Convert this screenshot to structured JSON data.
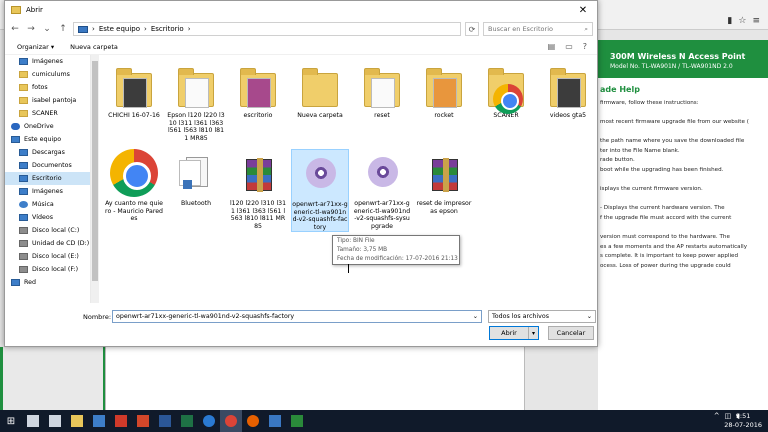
{
  "dialog": {
    "title": "Abrir",
    "close_label": "✕",
    "address": {
      "segments": [
        "Este equipo",
        "Escritorio"
      ]
    },
    "search_placeholder": "Buscar en Escritorio",
    "toolbar": {
      "organize": "Organizar ▾",
      "new_folder": "Nueva carpeta"
    }
  },
  "nav_pane": [
    {
      "label": "Imágenes",
      "icon": "blue",
      "indent": 14
    },
    {
      "label": "cumiculums",
      "icon": "folder",
      "indent": 14
    },
    {
      "label": "fotos",
      "icon": "folder",
      "indent": 14
    },
    {
      "label": "isabel pantoja",
      "icon": "folder",
      "indent": 14
    },
    {
      "label": "SCANER",
      "icon": "folder",
      "indent": 14
    },
    {
      "label": "OneDrive",
      "icon": "cloud",
      "indent": 6
    },
    {
      "label": "Este equipo",
      "icon": "blue",
      "indent": 6
    },
    {
      "label": "Descargas",
      "icon": "blue",
      "indent": 14
    },
    {
      "label": "Documentos",
      "icon": "blue",
      "indent": 14
    },
    {
      "label": "Escritorio",
      "icon": "blue",
      "indent": 14,
      "selected": true
    },
    {
      "label": "Imágenes",
      "icon": "blue",
      "indent": 14
    },
    {
      "label": "Música",
      "icon": "music",
      "indent": 14
    },
    {
      "label": "Vídeos",
      "icon": "blue",
      "indent": 14
    },
    {
      "label": "Disco local (C:)",
      "icon": "drive",
      "indent": 14
    },
    {
      "label": "Unidad de CD (D:)",
      "icon": "drive",
      "indent": 14
    },
    {
      "label": "Disco local (E:)",
      "icon": "drive",
      "indent": 14
    },
    {
      "label": "Disco local (F:)",
      "icon": "drive",
      "indent": 14
    },
    {
      "label": "Red",
      "icon": "blue",
      "indent": 6
    }
  ],
  "files": [
    {
      "label": "CHICHI 16-07-16",
      "type": "folder",
      "paper": "dark"
    },
    {
      "label": "Epson l120 l220 l310 l311 l361 l363 l561 l563 l810 l811 MR85",
      "type": "folder",
      "paper": "light"
    },
    {
      "label": "escritorio",
      "type": "folder",
      "paper": "purple"
    },
    {
      "label": "Nueva carpeta",
      "type": "folder",
      "paper": "none"
    },
    {
      "label": "reset",
      "type": "folder",
      "paper": "light"
    },
    {
      "label": "rocket",
      "type": "folder",
      "paper": "orange"
    },
    {
      "label": "SCANER",
      "type": "folder-chrome",
      "paper": "none"
    },
    {
      "label": "videos gta5",
      "type": "folder",
      "paper": "dark"
    },
    {
      "label": "Ay cuanto me quiero - Mauricio Paredes",
      "type": "chrome"
    },
    {
      "label": "Bluetooth",
      "type": "doc"
    },
    {
      "label": "l120 l220 l310 l311 l361 l363 l561 l563 l810 l811 MR85",
      "type": "rar"
    },
    {
      "label": "openwrt-ar71xx-generic-tl-wa901nd-v2-squashfs-factory",
      "type": "disc",
      "selected": true
    },
    {
      "label": "openwrt-ar71xx-generic-tl-wa901nd-v2-squashfs-sysupgrade",
      "type": "disc"
    },
    {
      "label": "reset de impresoras epson",
      "type": "rar"
    }
  ],
  "tooltip": {
    "type": "Tipo: BIN File",
    "size": "Tamaño: 3,75 MB",
    "modified": "Fecha de modificación: 17-07-2016 21:13"
  },
  "footer": {
    "filename_label": "Nombre:",
    "filename_value": "openwrt-ar71xx-generic-tl-wa901nd-v2-squashfs-factory",
    "filetype_value": "Todos los archivos",
    "open_label": "Abrir",
    "cancel_label": "Cancelar"
  },
  "router_page": {
    "banner_title": "300M Wireless N Access Point",
    "banner_model": "Model No. TL-WA901N / TL-WA901ND 2.0",
    "help_title": "ade Help",
    "lines": [
      "firmware, follow these instructions:",
      "",
      "most recent firmware upgrade file from our website (",
      "",
      "the path name where you save the downloaded file",
      "ter into the File Name blank.",
      "rade button.",
      "boot while the upgrading has been finished.",
      "",
      "isplays the current firmware version.",
      "",
      " - Displays the current hardware version. The",
      "f the upgrade file must accord with the current",
      "",
      "version must correspond to the hardware. The",
      "es a few moments and the AP restarts automatically",
      "s complete. It is important to keep power applied",
      "ocess. Loss of power during the upgrade could"
    ]
  },
  "taskbar": {
    "clock_time": "9:51",
    "clock_date": "28-07-2016",
    "apps": [
      {
        "name": "search",
        "color": "#cfd6e0"
      },
      {
        "name": "task-view",
        "color": "#cfd6e0"
      },
      {
        "name": "explorer",
        "color": "#e8c65a"
      },
      {
        "name": "store",
        "color": "#3d7ec9"
      },
      {
        "name": "acrobat",
        "color": "#d03a2a"
      },
      {
        "name": "powerpoint",
        "color": "#d2472a"
      },
      {
        "name": "word",
        "color": "#2b5797"
      },
      {
        "name": "excel",
        "color": "#1e7145"
      },
      {
        "name": "edge",
        "color": "#2a7ad2"
      },
      {
        "name": "chrome",
        "color": "#db4437"
      },
      {
        "name": "firefox",
        "color": "#e66000"
      },
      {
        "name": "app-blue",
        "color": "#3a78c2"
      },
      {
        "name": "app-green",
        "color": "#2a8a3a"
      }
    ]
  }
}
